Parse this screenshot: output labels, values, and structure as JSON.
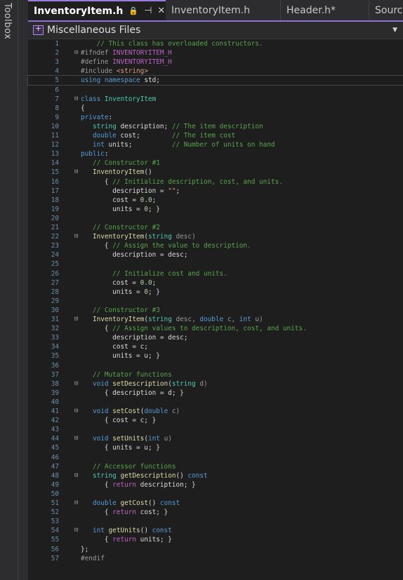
{
  "toolbox": {
    "label": "Toolbox"
  },
  "tabs": [
    {
      "label": "InventoryItem.h",
      "lock_icon": "🔒",
      "pin_icon": "⊣",
      "close_icon": "✕",
      "active": true
    },
    {
      "label": "InventoryItem.h"
    },
    {
      "label": "Header.h*"
    },
    {
      "label": "Sourc"
    }
  ],
  "navbar": {
    "project": "Miscellaneous Files",
    "dropdown_icon": "▼"
  },
  "editor": {
    "lines": [
      {
        "n": "1",
        "fold": "",
        "tokens": [
          [
            "    ",
            ""
          ],
          [
            "// This class has overloaded constructors.",
            "cm"
          ]
        ]
      },
      {
        "n": "2",
        "fold": "⊟",
        "tokens": [
          [
            "#ifndef ",
            "pp"
          ],
          [
            "INVENTORYITEM_H",
            "mac"
          ]
        ]
      },
      {
        "n": "3",
        "fold": "",
        "tokens": [
          [
            "#define ",
            "pp"
          ],
          [
            "INVENTORYITEM_H",
            "mac"
          ]
        ]
      },
      {
        "n": "4",
        "fold": "",
        "tokens": [
          [
            "#include ",
            "pp"
          ],
          [
            "<string>",
            "st"
          ]
        ]
      },
      {
        "n": "5",
        "fold": "",
        "tokens": [
          [
            "using",
            "kw"
          ],
          [
            " ",
            ""
          ],
          [
            "namespace",
            "kw"
          ],
          [
            " std;",
            "va"
          ]
        ],
        "current": true
      },
      {
        "n": "6",
        "fold": "",
        "tokens": []
      },
      {
        "n": "7",
        "fold": "⊟",
        "tokens": [
          [
            "class",
            "kw"
          ],
          [
            " ",
            ""
          ],
          [
            "InventoryItem",
            "ty"
          ]
        ]
      },
      {
        "n": "8",
        "fold": "",
        "tokens": [
          [
            "{",
            "va"
          ]
        ]
      },
      {
        "n": "9",
        "fold": "",
        "tokens": [
          [
            "private",
            "kw"
          ],
          [
            ":",
            "va"
          ]
        ]
      },
      {
        "n": "10",
        "fold": "",
        "tokens": [
          [
            "   ",
            ""
          ],
          [
            "string",
            "ty"
          ],
          [
            " description; ",
            "va"
          ],
          [
            "// The item description",
            "cm"
          ]
        ]
      },
      {
        "n": "11",
        "fold": "",
        "tokens": [
          [
            "   ",
            ""
          ],
          [
            "double",
            "kw"
          ],
          [
            " cost;        ",
            "va"
          ],
          [
            "// The item cost",
            "cm"
          ]
        ]
      },
      {
        "n": "12",
        "fold": "",
        "tokens": [
          [
            "   ",
            ""
          ],
          [
            "int",
            "kw"
          ],
          [
            " units;          ",
            "va"
          ],
          [
            "// Number of units on hand",
            "cm"
          ]
        ]
      },
      {
        "n": "13",
        "fold": "",
        "tokens": [
          [
            "public",
            "kw"
          ],
          [
            ":",
            "va"
          ]
        ]
      },
      {
        "n": "14",
        "fold": "",
        "tokens": [
          [
            "   ",
            ""
          ],
          [
            "// Constructor #1",
            "cm"
          ]
        ]
      },
      {
        "n": "15",
        "fold": "⊟",
        "tokens": [
          [
            "   ",
            ""
          ],
          [
            "InventoryItem",
            "fn"
          ],
          [
            "()",
            "va"
          ]
        ]
      },
      {
        "n": "16",
        "fold": "",
        "tokens": [
          [
            "      { ",
            "va"
          ],
          [
            "// Initialize description, cost, and units.",
            "cm"
          ]
        ]
      },
      {
        "n": "17",
        "fold": "",
        "tokens": [
          [
            "        description = ",
            "va"
          ],
          [
            "\"\"",
            "st"
          ],
          [
            ";",
            "va"
          ]
        ]
      },
      {
        "n": "18",
        "fold": "",
        "tokens": [
          [
            "        cost = ",
            "va"
          ],
          [
            "0.0",
            "nu"
          ],
          [
            ";",
            "va"
          ]
        ]
      },
      {
        "n": "19",
        "fold": "",
        "tokens": [
          [
            "        units = ",
            "va"
          ],
          [
            "0",
            "nu"
          ],
          [
            "; }",
            "va"
          ]
        ]
      },
      {
        "n": "20",
        "fold": "",
        "tokens": []
      },
      {
        "n": "21",
        "fold": "",
        "tokens": [
          [
            "   ",
            ""
          ],
          [
            "// Constructor #2",
            "cm"
          ]
        ]
      },
      {
        "n": "22",
        "fold": "⊟",
        "tokens": [
          [
            "   ",
            ""
          ],
          [
            "InventoryItem",
            "fn"
          ],
          [
            "(",
            "va"
          ],
          [
            "string",
            "ty"
          ],
          [
            " desc)",
            "pr"
          ]
        ]
      },
      {
        "n": "23",
        "fold": "",
        "tokens": [
          [
            "      { ",
            "va"
          ],
          [
            "// Assign the value to description.",
            "cm"
          ]
        ]
      },
      {
        "n": "24",
        "fold": "",
        "tokens": [
          [
            "        description = desc;",
            "va"
          ]
        ]
      },
      {
        "n": "25",
        "fold": "",
        "tokens": []
      },
      {
        "n": "26",
        "fold": "",
        "tokens": [
          [
            "        ",
            ""
          ],
          [
            "// Initialize cost and units.",
            "cm"
          ]
        ]
      },
      {
        "n": "27",
        "fold": "",
        "tokens": [
          [
            "        cost = ",
            "va"
          ],
          [
            "0.0",
            "nu"
          ],
          [
            ";",
            "va"
          ]
        ]
      },
      {
        "n": "28",
        "fold": "",
        "tokens": [
          [
            "        units = ",
            "va"
          ],
          [
            "0",
            "nu"
          ],
          [
            "; }",
            "va"
          ]
        ]
      },
      {
        "n": "29",
        "fold": "",
        "tokens": []
      },
      {
        "n": "30",
        "fold": "",
        "tokens": [
          [
            "   ",
            ""
          ],
          [
            "// Constructor #3",
            "cm"
          ]
        ]
      },
      {
        "n": "31",
        "fold": "⊟",
        "tokens": [
          [
            "   ",
            ""
          ],
          [
            "InventoryItem",
            "fn"
          ],
          [
            "(",
            "va"
          ],
          [
            "string",
            "ty"
          ],
          [
            " desc, ",
            "pr"
          ],
          [
            "double",
            "kw"
          ],
          [
            " c, ",
            "pr"
          ],
          [
            "int",
            "kw"
          ],
          [
            " u)",
            "pr"
          ]
        ]
      },
      {
        "n": "32",
        "fold": "",
        "tokens": [
          [
            "      { ",
            "va"
          ],
          [
            "// Assign values to description, cost, and units.",
            "cm"
          ]
        ]
      },
      {
        "n": "33",
        "fold": "",
        "tokens": [
          [
            "        description = desc;",
            "va"
          ]
        ]
      },
      {
        "n": "34",
        "fold": "",
        "tokens": [
          [
            "        cost = c;",
            "va"
          ]
        ]
      },
      {
        "n": "35",
        "fold": "",
        "tokens": [
          [
            "        units = u; }",
            "va"
          ]
        ]
      },
      {
        "n": "36",
        "fold": "",
        "tokens": []
      },
      {
        "n": "37",
        "fold": "",
        "tokens": [
          [
            "   ",
            ""
          ],
          [
            "// Mutator functions",
            "cm"
          ]
        ]
      },
      {
        "n": "38",
        "fold": "⊟",
        "tokens": [
          [
            "   ",
            ""
          ],
          [
            "void",
            "kw"
          ],
          [
            " ",
            ""
          ],
          [
            "setDescription",
            "fn"
          ],
          [
            "(",
            "va"
          ],
          [
            "string",
            "ty"
          ],
          [
            " d)",
            "pr"
          ]
        ]
      },
      {
        "n": "39",
        "fold": "",
        "tokens": [
          [
            "      { description = d; }",
            "va"
          ]
        ]
      },
      {
        "n": "40",
        "fold": "",
        "tokens": []
      },
      {
        "n": "41",
        "fold": "⊟",
        "tokens": [
          [
            "   ",
            ""
          ],
          [
            "void",
            "kw"
          ],
          [
            " ",
            ""
          ],
          [
            "setCost",
            "fn"
          ],
          [
            "(",
            "va"
          ],
          [
            "double",
            "kw"
          ],
          [
            " c)",
            "pr"
          ]
        ]
      },
      {
        "n": "42",
        "fold": "",
        "tokens": [
          [
            "      { cost = c; }",
            "va"
          ]
        ]
      },
      {
        "n": "43",
        "fold": "",
        "tokens": []
      },
      {
        "n": "44",
        "fold": "⊟",
        "tokens": [
          [
            "   ",
            ""
          ],
          [
            "void",
            "kw"
          ],
          [
            " ",
            ""
          ],
          [
            "setUnits",
            "fn"
          ],
          [
            "(",
            "va"
          ],
          [
            "int",
            "kw"
          ],
          [
            " u)",
            "pr"
          ]
        ]
      },
      {
        "n": "45",
        "fold": "",
        "tokens": [
          [
            "      { units = u; }",
            "va"
          ]
        ]
      },
      {
        "n": "46",
        "fold": "",
        "tokens": []
      },
      {
        "n": "47",
        "fold": "",
        "tokens": [
          [
            "   ",
            ""
          ],
          [
            "// Accessor functions",
            "cm"
          ]
        ]
      },
      {
        "n": "48",
        "fold": "⊟",
        "tokens": [
          [
            "   ",
            ""
          ],
          [
            "string",
            "ty"
          ],
          [
            " ",
            ""
          ],
          [
            "getDescription",
            "fn"
          ],
          [
            "() ",
            "va"
          ],
          [
            "const",
            "kw"
          ]
        ]
      },
      {
        "n": "49",
        "fold": "",
        "tokens": [
          [
            "      { ",
            "va"
          ],
          [
            "return",
            "mac"
          ],
          [
            " description; }",
            "va"
          ]
        ]
      },
      {
        "n": "50",
        "fold": "",
        "tokens": []
      },
      {
        "n": "51",
        "fold": "⊟",
        "tokens": [
          [
            "   ",
            ""
          ],
          [
            "double",
            "kw"
          ],
          [
            " ",
            ""
          ],
          [
            "getCost",
            "fn"
          ],
          [
            "() ",
            "va"
          ],
          [
            "const",
            "kw"
          ]
        ]
      },
      {
        "n": "52",
        "fold": "",
        "tokens": [
          [
            "      { ",
            "va"
          ],
          [
            "return",
            "mac"
          ],
          [
            " cost; }",
            "va"
          ]
        ]
      },
      {
        "n": "53",
        "fold": "",
        "tokens": []
      },
      {
        "n": "54",
        "fold": "⊟",
        "tokens": [
          [
            "   ",
            ""
          ],
          [
            "int",
            "kw"
          ],
          [
            " ",
            ""
          ],
          [
            "getUnits",
            "fn"
          ],
          [
            "() ",
            "va"
          ],
          [
            "const",
            "kw"
          ]
        ]
      },
      {
        "n": "55",
        "fold": "",
        "tokens": [
          [
            "      { ",
            "va"
          ],
          [
            "return",
            "mac"
          ],
          [
            " units; }",
            "va"
          ]
        ]
      },
      {
        "n": "56",
        "fold": "",
        "tokens": [
          [
            "};",
            "va"
          ]
        ]
      },
      {
        "n": "57",
        "fold": "",
        "tokens": [
          [
            "#endif",
            "pp"
          ]
        ]
      }
    ]
  }
}
